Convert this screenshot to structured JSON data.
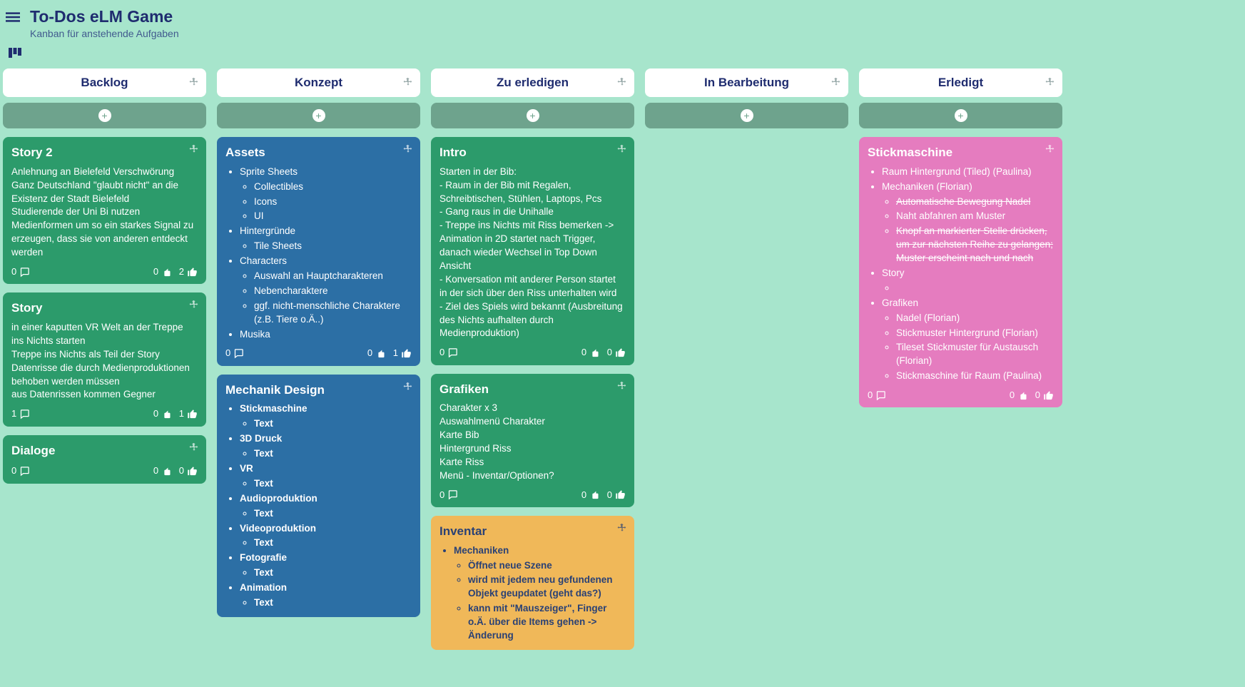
{
  "header": {
    "title": "To-Dos eLM Game",
    "subtitle": "Kanban für anstehende Aufgaben"
  },
  "columns": [
    {
      "title": "Backlog",
      "cards": [
        {
          "color": "green",
          "title": "Story 2",
          "body_text": "Anlehnung an Bielefeld Verschwörung\nGanz Deutschland \"glaubt nicht\" an die Existenz der Stadt Bielefeld\nStudierende der Uni Bi nutzen Medienformen um so ein starkes Signal zu erzeugen, dass sie von anderen entdeckt werden",
          "comments": 0,
          "down": 0,
          "up": 2
        },
        {
          "color": "green",
          "title": "Story",
          "body_text": "in einer kaputten VR Welt an der Treppe ins Nichts starten\nTreppe ins Nichts als Teil der Story\nDatenrisse die durch Medienproduktionen behoben werden müssen\naus Datenrissen kommen Gegner",
          "comments": 1,
          "down": 0,
          "up": 1
        },
        {
          "color": "green",
          "title": "Dialoge",
          "body_text": "",
          "comments": 0,
          "down": 0,
          "up": 0
        }
      ]
    },
    {
      "title": "Konzept",
      "cards": [
        {
          "color": "blue",
          "title": "Assets",
          "list": [
            {
              "t": "Sprite Sheets",
              "c": [
                {
                  "t": "Collectibles"
                },
                {
                  "t": "Icons"
                },
                {
                  "t": "UI"
                }
              ]
            },
            {
              "t": "Hintergründe",
              "c": [
                {
                  "t": "Tile Sheets"
                }
              ]
            },
            {
              "t": "Characters",
              "c": [
                {
                  "t": "Auswahl an Hauptcharakteren"
                },
                {
                  "t": "Nebencharaktere"
                },
                {
                  "t": "ggf. nicht-menschliche Charaktere (z.B. Tiere o.Ä..)"
                }
              ]
            },
            {
              "t": "Musika"
            }
          ],
          "comments": 0,
          "down": 0,
          "up": 1
        },
        {
          "color": "blue",
          "title": "Mechanik Design",
          "list": [
            {
              "t": "Stickmaschine",
              "b": true,
              "c": [
                {
                  "t": "Text",
                  "b": true
                }
              ]
            },
            {
              "t": "3D Druck",
              "b": true,
              "c": [
                {
                  "t": "Text",
                  "b": true
                }
              ]
            },
            {
              "t": "VR",
              "b": true,
              "c": [
                {
                  "t": "Text",
                  "b": true
                }
              ]
            },
            {
              "t": "Audioproduktion",
              "b": true,
              "c": [
                {
                  "t": "Text",
                  "b": true
                }
              ]
            },
            {
              "t": "Videoproduktion",
              "b": true,
              "c": [
                {
                  "t": "Text",
                  "b": true
                }
              ]
            },
            {
              "t": "Fotografie",
              "b": true,
              "c": [
                {
                  "t": "Text",
                  "b": true
                }
              ]
            },
            {
              "t": "Animation",
              "b": true,
              "c": [
                {
                  "t": "Text",
                  "b": true
                }
              ]
            }
          ],
          "no_footer": true
        }
      ]
    },
    {
      "title": "Zu erledigen",
      "cards": [
        {
          "color": "green",
          "title": "Intro",
          "body_text": "Starten in der Bib:\n- Raum in der Bib mit Regalen, Schreibtischen, Stühlen, Laptops, Pcs\n- Gang raus in die Unihalle\n- Treppe ins Nichts mit Riss bemerken -> Animation in 2D startet nach Trigger, danach wieder Wechsel in Top Down Ansicht\n- Konversation mit anderer Person startet in der sich über den Riss unterhalten wird\n- Ziel des Spiels wird bekannt (Ausbreitung des Nichts aufhalten durch Medienproduktion)",
          "comments": 0,
          "down": 0,
          "up": 0
        },
        {
          "color": "green",
          "title": "Grafiken",
          "body_text": "Charakter x 3\nAuswahlmenü Charakter\nKarte Bib\nHintergrund Riss\nKarte Riss\nMenü - Inventar/Optionen?",
          "comments": 0,
          "down": 0,
          "up": 0
        },
        {
          "color": "yellow",
          "title": "Inventar",
          "list": [
            {
              "t": "Mechaniken",
              "b": true,
              "c": [
                {
                  "t": "Öffnet neue Szene"
                },
                {
                  "t": "wird mit jedem neu gefundenen Objekt geupdatet (geht das?)"
                },
                {
                  "t": "kann mit \"Mauszeiger\", Finger o.Ä. über die Items gehen -> Änderung"
                }
              ]
            }
          ],
          "no_footer": true
        }
      ]
    },
    {
      "title": "In Bearbeitung",
      "cards": []
    },
    {
      "title": "Erledigt",
      "cards": [
        {
          "color": "pink",
          "title": "Stickmaschine",
          "list": [
            {
              "t": "Raum Hintergrund (Tiled) (Paulina)"
            },
            {
              "t": "Mechaniken (Florian)",
              "c": [
                {
                  "t": "Automatische Bewegung Nadel",
                  "s": true
                },
                {
                  "t": "Naht abfahren am Muster"
                },
                {
                  "t": "Knopf an markierter Stelle drücken, um zur nächsten Reihe zu gelangen; Muster erscheint nach und nach",
                  "s": true
                }
              ]
            },
            {
              "t": "Story",
              "c": [
                {
                  "t": ""
                }
              ]
            },
            {
              "t": "Grafiken",
              "c": [
                {
                  "t": "Nadel (Florian)"
                },
                {
                  "t": "Stickmuster Hintergrund (Florian)"
                },
                {
                  "t": "Tileset Stickmuster für Austausch (Florian)"
                },
                {
                  "t": "Stickmaschine für Raum (Paulina)"
                }
              ]
            }
          ],
          "comments": 0,
          "down": 0,
          "up": 0
        }
      ]
    }
  ]
}
